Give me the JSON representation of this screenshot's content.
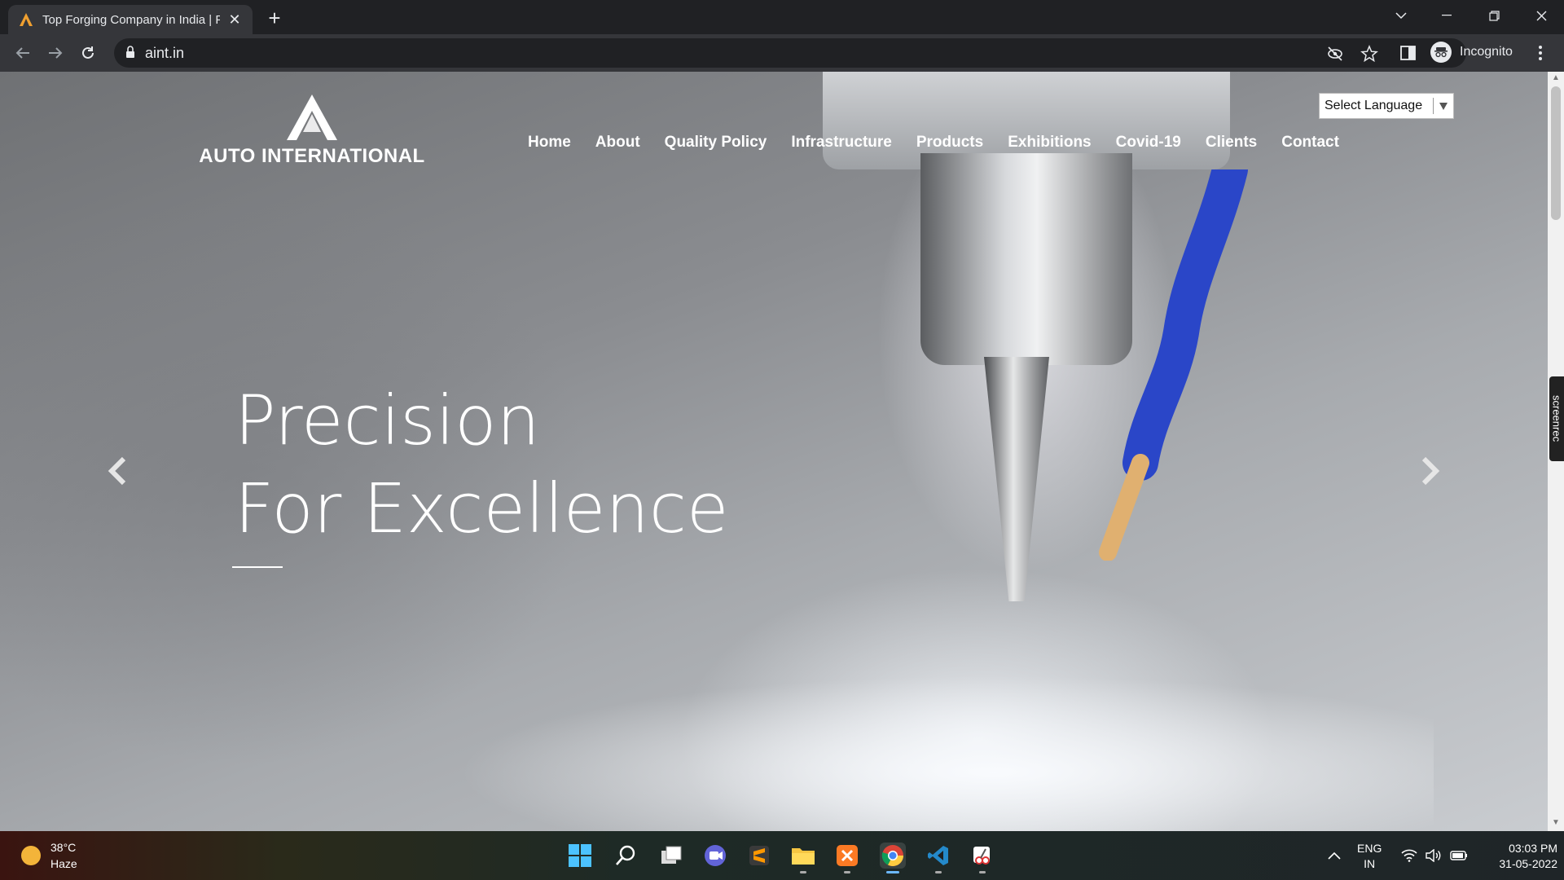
{
  "browser": {
    "tab_title": "Top Forging Company in India | F",
    "new_tab": "+",
    "url": "aint.in",
    "profile_label": "Incognito"
  },
  "site": {
    "logo_text": "AUTO INTERNATIONAL",
    "nav": [
      "Home",
      "About",
      "Quality Policy",
      "Infrastructure",
      "Products",
      "Exhibitions",
      "Covid-19",
      "Clients",
      "Contact"
    ],
    "language_select": "Select Language",
    "hero_line1": "Precision",
    "hero_line2": "For Excellence",
    "screenrec_label": "screenrec"
  },
  "taskbar": {
    "temperature": "38°C",
    "condition": "Haze",
    "lang_top": "ENG",
    "lang_bottom": "IN",
    "time": "03:03 PM",
    "date": "31-05-2022"
  },
  "colors": {
    "brand_accent": "#f0a030",
    "chrome_dark": "#202124",
    "chrome_toolbar": "#35363a"
  }
}
